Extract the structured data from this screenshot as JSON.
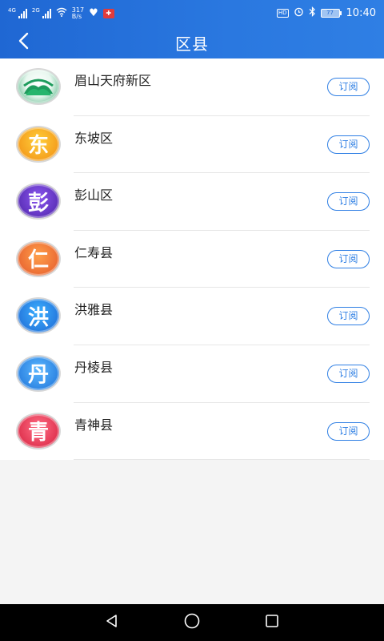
{
  "status_bar": {
    "net_tag_1": "4G",
    "net_tag_2": "2G",
    "speed_value": "317",
    "speed_unit": "B/s",
    "hd_label": "HD",
    "battery": "77",
    "time": "10:40",
    "icons": [
      "signal-icon",
      "signal-icon",
      "wifi-icon",
      "heart-icon",
      "app-badge-icon",
      "hd-icon",
      "alarm-icon",
      "bluetooth-icon",
      "battery-icon"
    ]
  },
  "header": {
    "title": "区县",
    "back_icon": "chevron-left-icon"
  },
  "districts": [
    {
      "name": "眉山天府新区",
      "logo_char": "",
      "button": "订阅"
    },
    {
      "name": "东坡区",
      "logo_char": "东",
      "button": "订阅"
    },
    {
      "name": "彭山区",
      "logo_char": "彭",
      "button": "订阅"
    },
    {
      "name": "仁寿县",
      "logo_char": "仁",
      "button": "订阅"
    },
    {
      "name": "洪雅县",
      "logo_char": "洪",
      "button": "订阅"
    },
    {
      "name": "丹棱县",
      "logo_char": "丹",
      "button": "订阅"
    },
    {
      "name": "青神县",
      "logo_char": "青",
      "button": "订阅"
    }
  ],
  "colors": {
    "header_bg": "#2a78e0",
    "accent": "#2f7fe4"
  },
  "system_nav": [
    "back-triangle-icon",
    "home-circle-icon",
    "recents-square-icon"
  ]
}
